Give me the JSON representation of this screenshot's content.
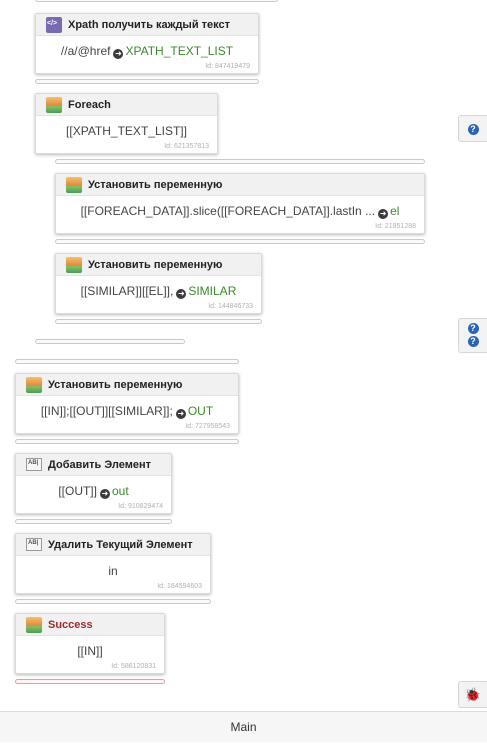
{
  "blocks": [
    {
      "title": "Xpath получить каждый текст",
      "icon": "xpath-icon",
      "body": "//a/@href",
      "out": "XPATH_TEXT_LIST",
      "id": "Id: 847419479"
    },
    {
      "title": "Foreach",
      "icon": "variable-icon",
      "body": "[[XPATH_TEXT_LIST]]",
      "out": "",
      "id": "Id: 621357813"
    },
    {
      "title": "Установить переменную",
      "icon": "variable-icon",
      "body": "[[FOREACH_DATA]].slice([[FOREACH_DATA]].lastIn ...",
      "out": "el",
      "id": "Id: 21851288"
    },
    {
      "title": "Установить переменную",
      "icon": "variable-icon",
      "body": "[[SIMILAR]][[EL]],",
      "out": "SIMILAR",
      "id": "Id: 144846733"
    },
    {
      "title": "Установить переменную",
      "icon": "variable-icon",
      "body": "[[IN]];[[OUT]][[SIMILAR]];",
      "out": "OUT",
      "id": "Id: 727958543"
    },
    {
      "title": "Добавить Элемент",
      "icon": "list-icon",
      "body": "[[OUT]]",
      "out": "out",
      "id": "Id: 910829474"
    },
    {
      "title": "Удалить Текущий Элемент",
      "icon": "list-icon",
      "body": "in",
      "out": "",
      "id": "Id: 184594603"
    },
    {
      "title": "Success",
      "icon": "variable-icon",
      "body": "[[IN]]",
      "out": "",
      "id": "Id: 586120831"
    }
  ],
  "side_buttons": {
    "help_1": "?",
    "help_2a": "?",
    "help_2b": "?",
    "debug": "debug-icon"
  },
  "footer": {
    "label": "Main"
  },
  "colors": {
    "accent_green": "#3a8a2b",
    "help_blue": "#2a64b8",
    "success_red": "#a12b2b"
  }
}
